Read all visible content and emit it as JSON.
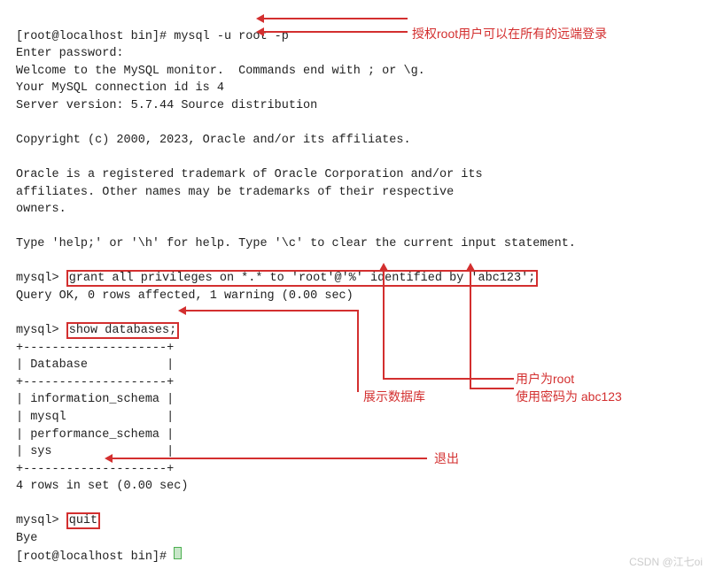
{
  "term": {
    "line1_a": "[root@localhost bin]# ",
    "line1_b": "mysql -u root -p",
    "line2": "Enter password:",
    "line3": "Welcome to the MySQL monitor.  Commands end with ; or \\g.",
    "line4": "Your MySQL connection id is 4",
    "line5": "Server version: 5.7.44 Source distribution",
    "line6": "",
    "line7": "Copyright (c) 2000, 2023, Oracle and/or its affiliates.",
    "line8": "",
    "line9": "Oracle is a registered trademark of Oracle Corporation and/or its",
    "line10": "affiliates. Other names may be trademarks of their respective",
    "line11": "owners.",
    "line12": "",
    "line13": "Type 'help;' or '\\h' for help. Type '\\c' to clear the current input statement.",
    "line14": "",
    "grant_prompt": "mysql> ",
    "grant_cmd": "grant all privileges on *.* to 'root'@'%' identified by 'abc123';",
    "grant_result": "Query OK, 0 rows affected, 1 warning (0.00 sec)",
    "showdb_prompt": "mysql> ",
    "showdb_cmd": "show databases;",
    "tbl_border": "+--------------------+",
    "tbl_header": "| Database           |",
    "tbl_r1": "| information_schema |",
    "tbl_r2": "| mysql              |",
    "tbl_r3": "| performance_schema |",
    "tbl_r4": "| sys                |",
    "tbl_result": "4 rows in set (0.00 sec)",
    "quit_prompt": "mysql> ",
    "quit_cmd": "quit",
    "bye": "Bye",
    "final_prompt": "[root@localhost bin]# "
  },
  "anno": {
    "top": "授权root用户可以在所有的远端登录",
    "show": "展示数据库",
    "user1": "用户为root",
    "user2": "使用密码为 abc123",
    "quit": "退出"
  },
  "watermark": "CSDN @江七oi"
}
